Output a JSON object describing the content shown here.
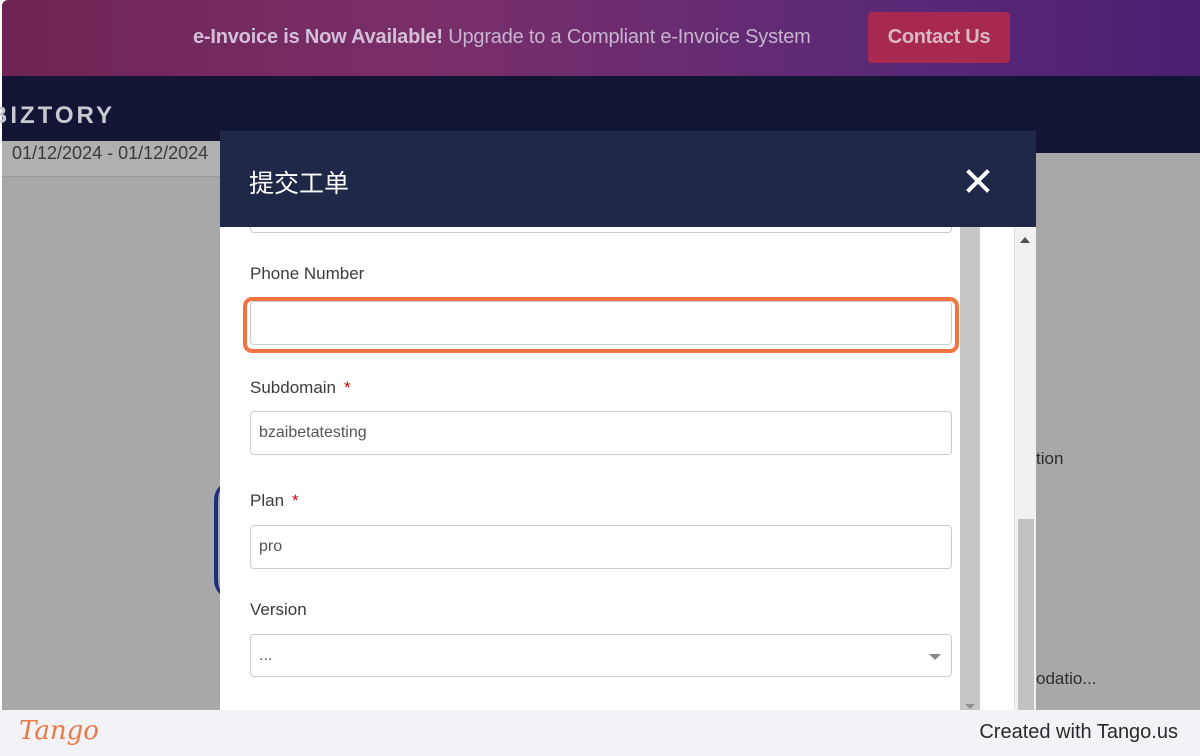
{
  "banner": {
    "headline": "e-Invoice is Now Available!",
    "subtext": "Upgrade to a Compliant e-Invoice System",
    "contact_label": "Contact Us"
  },
  "appbar": {
    "logo": "BIZTORY"
  },
  "background": {
    "date_range": "01/12/2024 - 01/12/2024",
    "right_text_1": "tion",
    "right_text_2": "odatio..."
  },
  "modal": {
    "title": "提交工单",
    "fields": {
      "phone": {
        "label": "Phone Number",
        "value": ""
      },
      "subdomain": {
        "label": "Subdomain",
        "required_mark": "*",
        "value": "bzaibetatesting"
      },
      "plan": {
        "label": "Plan",
        "required_mark": "*",
        "value": "pro"
      },
      "version": {
        "label": "Version",
        "value": "..."
      }
    }
  },
  "footer": {
    "logo": "Tango",
    "credit": "Created with Tango.us"
  },
  "colors": {
    "modal_header": "#1f2847",
    "highlight": "#f07543",
    "contact_button": "#a8294f",
    "required": "#d10000"
  }
}
